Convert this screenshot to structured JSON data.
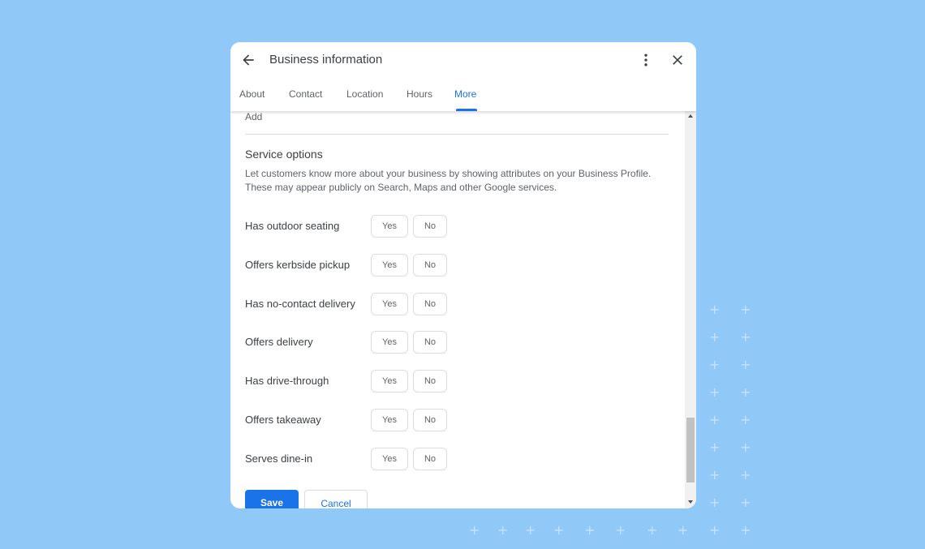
{
  "dialog": {
    "title": "Business information",
    "icons": {
      "back": "arrow-left-icon",
      "more": "more-vert-icon",
      "close": "close-icon"
    },
    "tabs": [
      {
        "label": "About",
        "active": false
      },
      {
        "label": "Contact",
        "active": false
      },
      {
        "label": "Location",
        "active": false
      },
      {
        "label": "Hours",
        "active": false
      },
      {
        "label": "More",
        "active": true
      }
    ]
  },
  "content": {
    "add_label": "Add",
    "section_title": "Service options",
    "section_description": "Let customers know more about your business by showing attributes on your Business Profile. These may appear publicly on Search, Maps and other Google services.",
    "attributes": [
      {
        "label": "Has outdoor seating",
        "yes": "Yes",
        "no": "No"
      },
      {
        "label": "Offers kerbside pickup",
        "yes": "Yes",
        "no": "No"
      },
      {
        "label": "Has no-contact delivery",
        "yes": "Yes",
        "no": "No"
      },
      {
        "label": "Offers delivery",
        "yes": "Yes",
        "no": "No"
      },
      {
        "label": "Has drive-through",
        "yes": "Yes",
        "no": "No"
      },
      {
        "label": "Offers takeaway",
        "yes": "Yes",
        "no": "No"
      },
      {
        "label": "Serves dine-in",
        "yes": "Yes",
        "no": "No"
      }
    ],
    "save_label": "Save",
    "cancel_label": "Cancel"
  },
  "colors": {
    "accent": "#1a73e8",
    "background": "#90c8f8"
  }
}
